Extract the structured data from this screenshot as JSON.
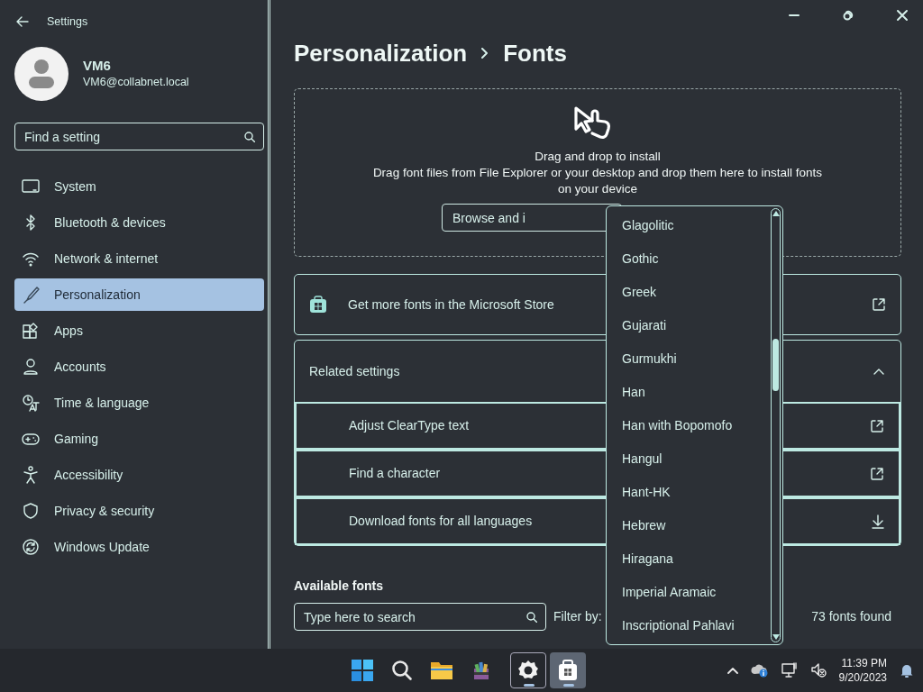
{
  "window": {
    "title": "Settings"
  },
  "user": {
    "name": "VM6",
    "email": "VM6@collabnet.local"
  },
  "search": {
    "placeholder": "Find a setting"
  },
  "nav": [
    {
      "label": "System",
      "selected": false
    },
    {
      "label": "Bluetooth & devices",
      "selected": false
    },
    {
      "label": "Network & internet",
      "selected": false
    },
    {
      "label": "Personalization",
      "selected": true
    },
    {
      "label": "Apps",
      "selected": false
    },
    {
      "label": "Accounts",
      "selected": false
    },
    {
      "label": "Time & language",
      "selected": false
    },
    {
      "label": "Gaming",
      "selected": false
    },
    {
      "label": "Accessibility",
      "selected": false
    },
    {
      "label": "Privacy & security",
      "selected": false
    },
    {
      "label": "Windows Update",
      "selected": false
    }
  ],
  "breadcrumb": [
    "Personalization",
    "Fonts"
  ],
  "drop_zone": {
    "title": "Drag and drop to install",
    "text": "Drag font files from File Explorer or your desktop and drop them here to install fonts on your device",
    "button": "Browse and i"
  },
  "store_link": {
    "label": "Get more fonts in the Microsoft Store"
  },
  "related": {
    "title": "Related settings",
    "expanded": true,
    "items": [
      {
        "label": "Adjust ClearType text",
        "kind": "link"
      },
      {
        "label": "Find a character",
        "kind": "link"
      },
      {
        "label": "Download fonts for all languages",
        "kind": "download"
      }
    ]
  },
  "available": {
    "title": "Available fonts",
    "search_placeholder": "Type here to search",
    "filter_label": "Filter by:",
    "count": "73 fonts found"
  },
  "filter_dropdown": {
    "options": [
      "Glagolitic",
      "Gothic",
      "Greek",
      "Gujarati",
      "Gurmukhi",
      "Han",
      "Han with Bopomofo",
      "Hangul",
      "Hant-HK",
      "Hebrew",
      "Hiragana",
      "Imperial Aramaic",
      "Inscriptional Pahlavi"
    ]
  },
  "taskbar": {
    "apps": [
      {
        "kind": "start",
        "open": false,
        "selected": false
      },
      {
        "kind": "search",
        "open": false,
        "selected": false
      },
      {
        "kind": "explorer",
        "open": false,
        "selected": false
      },
      {
        "kind": "archiver",
        "open": false,
        "selected": false
      },
      {
        "kind": "settings",
        "open": true,
        "selected": false
      },
      {
        "kind": "store",
        "open": true,
        "selected": true
      }
    ],
    "time": "11:39 PM",
    "date": "9/20/2023"
  }
}
